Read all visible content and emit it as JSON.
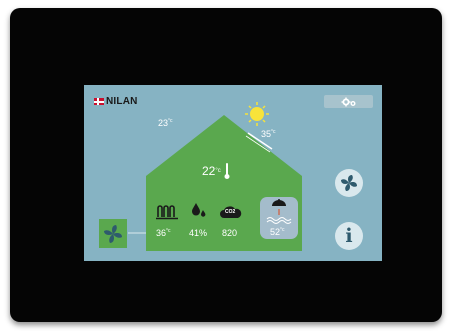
{
  "brand": {
    "name": "NILAN"
  },
  "temps": {
    "outdoor_shade": "23",
    "outdoor_sun": "35",
    "indoor": "22",
    "unit": "°c"
  },
  "readouts": {
    "heating_temp": "36",
    "humidity": "41%",
    "co2": "820",
    "co2_icon_label": "CO2",
    "hot_water_temp": "52"
  },
  "colors": {
    "screen": "#86b3c3",
    "house": "#5aa84e",
    "sun": "#f7e33a",
    "accent_icon": "#2e5a6d"
  },
  "icons": {
    "settings": "gears-icon",
    "fan": "fan-icon",
    "info": "info-icon"
  }
}
